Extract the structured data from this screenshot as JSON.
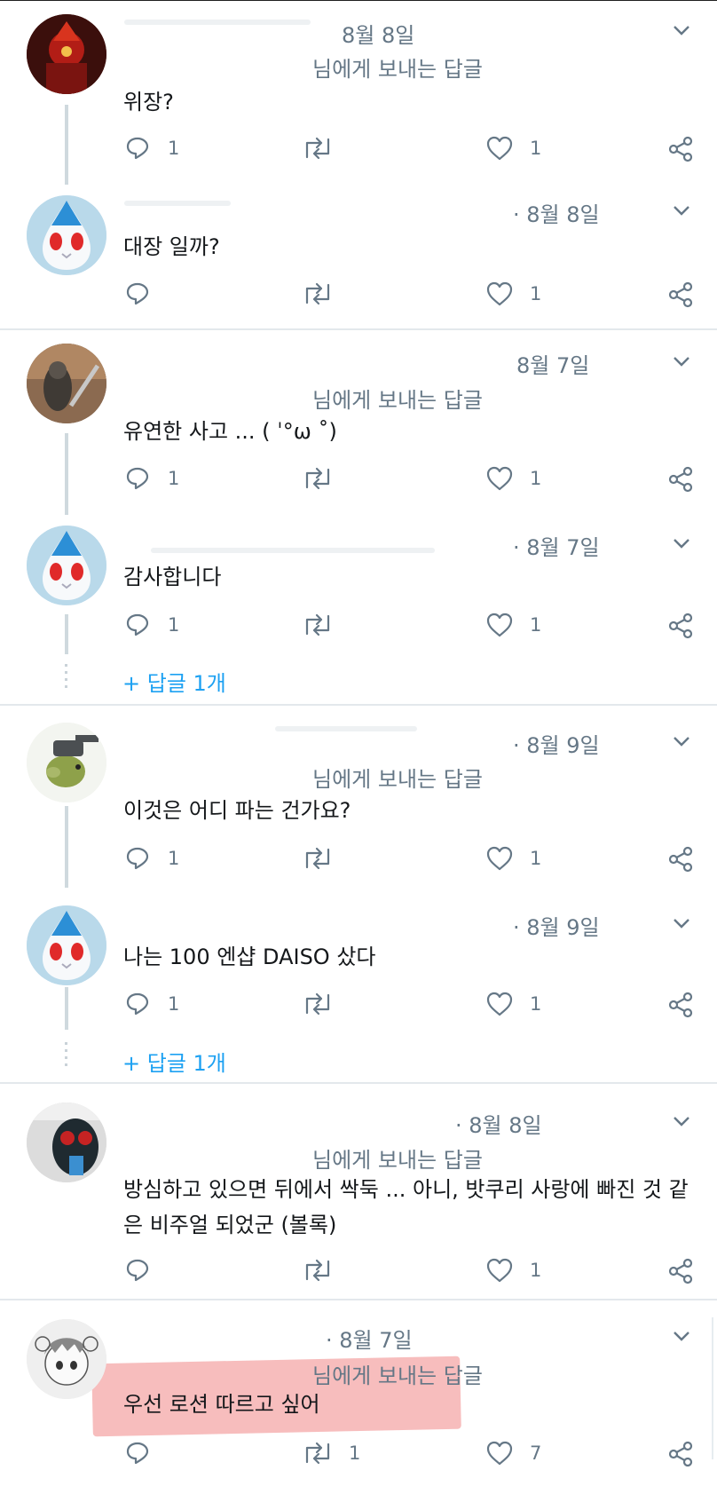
{
  "colors": {
    "accent": "#1da1f2",
    "muted": "#657786",
    "highlight": "#f4a7a7"
  },
  "reply_to_text": "님에게 보내는 답글",
  "more_replies_label": "+ 답글 1개",
  "tweets": [
    {
      "date": "8월 8일",
      "show_reply_to": true,
      "text": "위장?",
      "reply_count": "1",
      "retweet_count": "",
      "like_count": "1"
    },
    {
      "date": "· 8월 8일",
      "show_reply_to": false,
      "text": "대장 일까?",
      "reply_count": "",
      "retweet_count": "",
      "like_count": "1"
    },
    {
      "date": "8월 7일",
      "show_reply_to": true,
      "text": "유연한 사고 ... ( ˈ°ω ˚)",
      "reply_count": "1",
      "retweet_count": "",
      "like_count": "1"
    },
    {
      "date": "· 8월 7일",
      "show_reply_to": false,
      "text": "감사합니다",
      "reply_count": "1",
      "retweet_count": "",
      "like_count": "1"
    },
    {
      "date": "· 8월 9일",
      "show_reply_to": true,
      "text": "이것은 어디 파는 건가요?",
      "reply_count": "1",
      "retweet_count": "",
      "like_count": "1"
    },
    {
      "date": "· 8월 9일",
      "show_reply_to": false,
      "text": "나는 100 엔샵 DAISO 샀다",
      "reply_count": "1",
      "retweet_count": "",
      "like_count": "1"
    },
    {
      "date": "· 8월 8일",
      "show_reply_to": true,
      "text": "방심하고 있으면 뒤에서 싹둑 ... 아니, 밧쿠리 사랑에 빠진 것 같은 비주얼 되었군 (볼록)",
      "reply_count": "",
      "retweet_count": "",
      "like_count": "1"
    },
    {
      "date": "· 8월 7일",
      "show_reply_to": true,
      "text": "우선 로션 따르고 싶어",
      "reply_count": "",
      "retweet_count": "1",
      "like_count": "7"
    }
  ]
}
